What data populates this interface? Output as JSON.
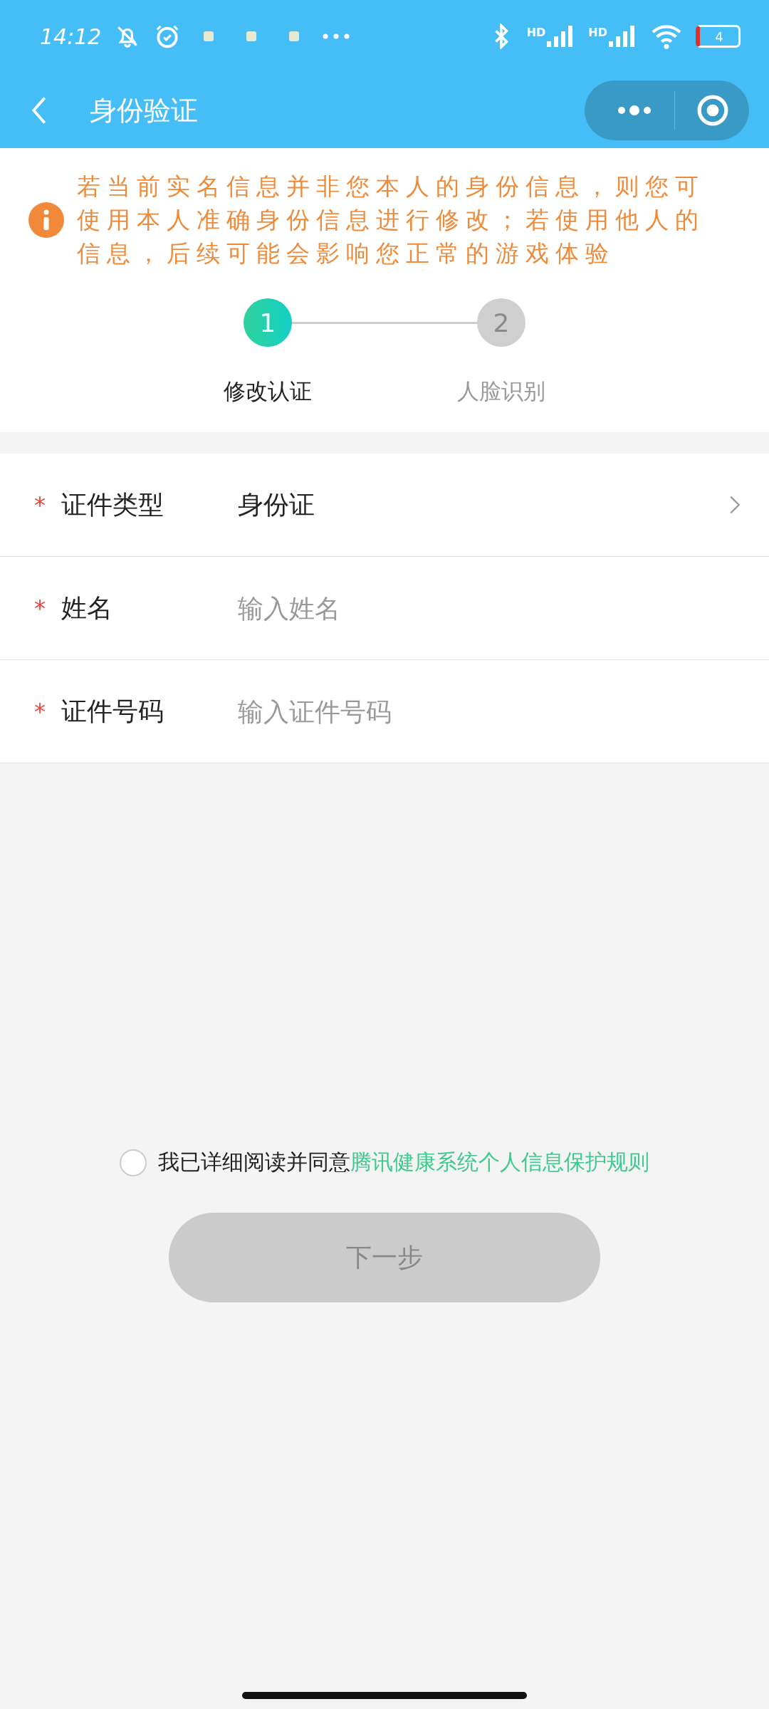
{
  "status_bar": {
    "time": "14:12",
    "signal_labels": [
      "HD",
      "HD"
    ],
    "battery": "4"
  },
  "header": {
    "title": "身份验证"
  },
  "notice": {
    "text": "若当前实名信息并非您本人的身份信息，则您可使用本人准确身份信息进行修改；若使用他人的信息，后续可能会影响您正常的游戏体验"
  },
  "steps": [
    {
      "number": "1",
      "label": "修改认证",
      "selected": true
    },
    {
      "number": "2",
      "label": "人脸识别",
      "selected": false
    }
  ],
  "form": [
    {
      "kind": "select",
      "label": "证件类型",
      "required_mark": "*",
      "value": "身份证"
    },
    {
      "kind": "input",
      "label": "姓名",
      "required_mark": "*",
      "placeholder": "输入姓名"
    },
    {
      "kind": "input",
      "label": "证件号码",
      "required_mark": "*",
      "placeholder": "输入证件号码"
    }
  ],
  "agreement": {
    "checked": false,
    "text": "我已详细阅读并同意",
    "link": "腾讯健康系统个人信息保护规则"
  },
  "next_button": {
    "label": "下一步",
    "disabled": true
  }
}
